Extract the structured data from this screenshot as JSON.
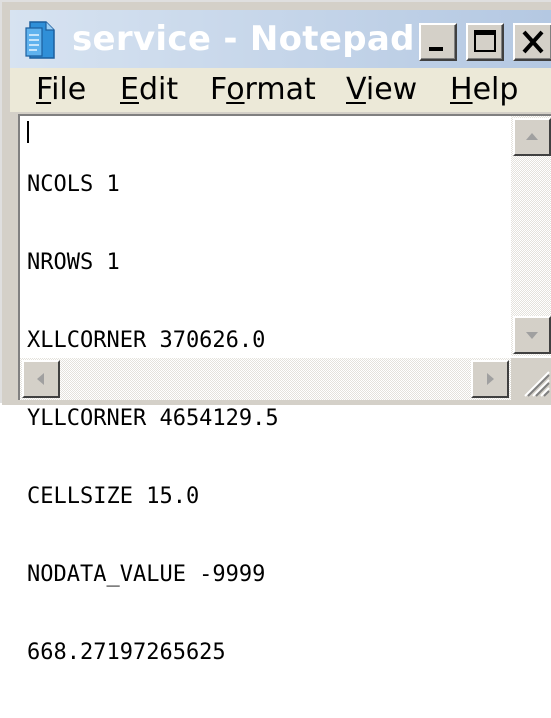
{
  "window": {
    "title": "service - Notepad",
    "icon": "notepad-icon",
    "controls": [
      "minimize-icon",
      "maximize-icon",
      "close-icon"
    ]
  },
  "menu": {
    "file": {
      "mnemonic": "F",
      "rest": "ile"
    },
    "edit": {
      "mnemonic": "E",
      "rest": "dit"
    },
    "format": {
      "before": "F",
      "mnemonic": "o",
      "rest": "rmat"
    },
    "view": {
      "mnemonic": "V",
      "rest": "iew"
    },
    "help": {
      "mnemonic": "H",
      "rest": "elp"
    }
  },
  "editor": {
    "lines": [
      "NCOLS 1",
      "NROWS 1",
      "XLLCORNER 370626.0",
      "YLLCORNER 4654129.5",
      "CELLSIZE 15.0",
      "NODATA_VALUE -9999",
      "668.27197265625"
    ]
  },
  "colors": {
    "title_gradient_start": "#d7e3f1",
    "title_gradient_end": "#b4c8e2",
    "title_text": "#ffffff",
    "chrome": "#d4d0c8",
    "menubar": "#ece9d8"
  }
}
